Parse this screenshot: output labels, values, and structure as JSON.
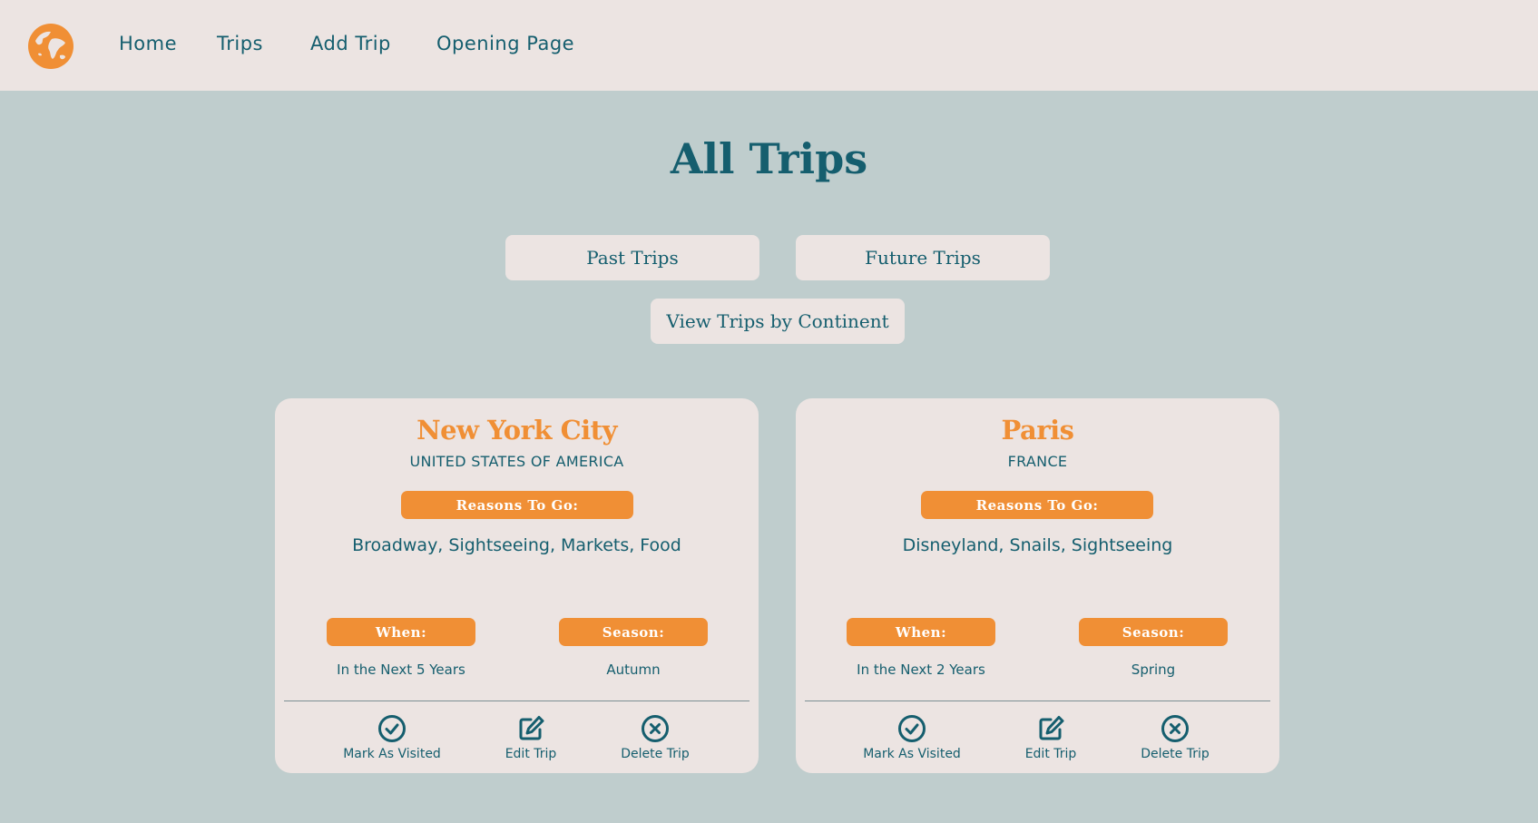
{
  "nav": {
    "links": [
      "Home",
      "Trips",
      "Add Trip",
      "Opening Page"
    ]
  },
  "page_title": "All Trips",
  "filters": {
    "past": "Past Trips",
    "future": "Future Trips",
    "continent": "View Trips by Continent"
  },
  "labels": {
    "reasons": "Reasons To Go:",
    "when": "When:",
    "season": "Season:",
    "mark_visited": "Mark As Visited",
    "edit": "Edit Trip",
    "delete": "Delete Trip"
  },
  "trips": [
    {
      "city": "New York City",
      "country": "UNITED STATES OF AMERICA",
      "reasons": "Broadway, Sightseeing, Markets, Food",
      "when": "In the Next 5 Years",
      "season": "Autumn"
    },
    {
      "city": "Paris",
      "country": "FRANCE",
      "reasons": "Disneyland, Snails, Sightseeing",
      "when": "In the Next 2 Years",
      "season": "Spring"
    }
  ],
  "colors": {
    "background": "#bfcdcd",
    "navbar": "#ece4e2",
    "card": "#ece4e2",
    "accent": "#f08f35",
    "text": "#155e6e"
  },
  "icons": {
    "logo": "globe-icon",
    "mark_visited": "check-circle-icon",
    "edit": "edit-icon",
    "delete": "x-circle-icon"
  }
}
